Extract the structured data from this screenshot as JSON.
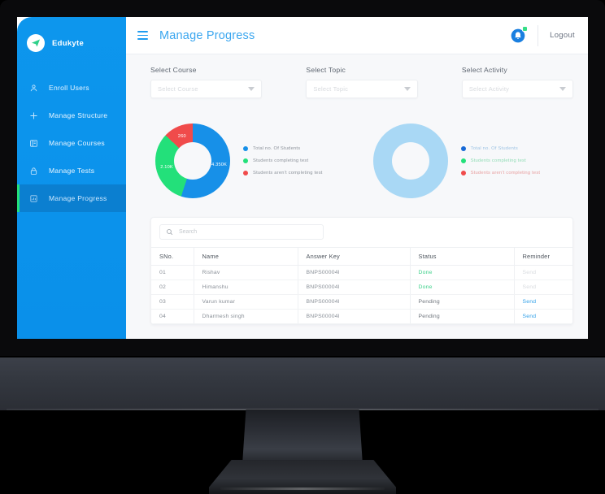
{
  "brand": {
    "name": "Edukyte",
    "logo_icon": "paper-plane-icon"
  },
  "sidebar": {
    "items": [
      {
        "label": "Enroll Users",
        "icon": "user-icon",
        "active": false
      },
      {
        "label": "Manage Structure",
        "icon": "plus-icon",
        "active": false
      },
      {
        "label": "Manage Courses",
        "icon": "book-icon",
        "active": false
      },
      {
        "label": "Manage Tests",
        "icon": "lock-icon",
        "active": false
      },
      {
        "label": "Manage Progress",
        "icon": "chart-icon",
        "active": true
      }
    ]
  },
  "topbar": {
    "menu_icon": "hamburger-icon",
    "title": "Manage Progress",
    "notification_icon": "bell-icon",
    "logout_label": "Logout"
  },
  "filters": [
    {
      "label": "Select Course",
      "placeholder": "Select Course",
      "value": ""
    },
    {
      "label": "Select Topic",
      "placeholder": "Select Topic",
      "value": ""
    },
    {
      "label": "Select Activity",
      "placeholder": "Select Activity",
      "value": ""
    }
  ],
  "colors": {
    "brand_blue": "#0d96ed",
    "accent_green": "#23e07a",
    "series_blue": "#1790e8",
    "series_green": "#23e07a",
    "series_red": "#f04b4b",
    "chart2_fill": "#a9d8f5",
    "status_done": "#3fd18b",
    "link_blue": "#2f9fe8"
  },
  "chart_data": [
    {
      "type": "pie",
      "title": "",
      "legend_position": "right",
      "categories": [
        "Total no. Of Students",
        "Students completing test",
        "Students aren't completing test"
      ],
      "values": [
        55,
        32,
        13
      ],
      "colors": [
        "#1790e8",
        "#23e07a",
        "#f04b4b"
      ],
      "data_labels": [
        "4.350K",
        "2.10K",
        "260"
      ]
    },
    {
      "type": "pie",
      "title": "",
      "legend_position": "right",
      "categories": [
        "Total no. Of Students",
        "Students completing test",
        "Students aren't completing test"
      ],
      "values": [
        100,
        0,
        0
      ],
      "colors": [
        "#a9d8f5",
        "#a9d8f5",
        "#a9d8f5"
      ],
      "legend_colors": [
        "#1769d6",
        "#23e07a",
        "#f04b4b"
      ],
      "data_labels": []
    }
  ],
  "search": {
    "placeholder": "Search",
    "value": "",
    "icon": "search-icon"
  },
  "table": {
    "columns": [
      "SNo.",
      "Name",
      "Answer Key",
      "Status",
      "Reminder"
    ],
    "rows": [
      {
        "sno": "01",
        "name": "Rishav",
        "key": "BNPS00004I",
        "status": "Done",
        "status_type": "done",
        "reminder": "Send",
        "reminder_active": false
      },
      {
        "sno": "02",
        "name": "Himanshu",
        "key": "BNPS00004I",
        "status": "Done",
        "status_type": "done",
        "reminder": "Send",
        "reminder_active": false
      },
      {
        "sno": "03",
        "name": "Varun kumar",
        "key": "BNPS00004I",
        "status": "Pending",
        "status_type": "pending",
        "reminder": "Send",
        "reminder_active": true
      },
      {
        "sno": "04",
        "name": "Dharmesh singh",
        "key": "BNPS00004I",
        "status": "Pending",
        "status_type": "pending",
        "reminder": "Send",
        "reminder_active": true
      }
    ]
  }
}
